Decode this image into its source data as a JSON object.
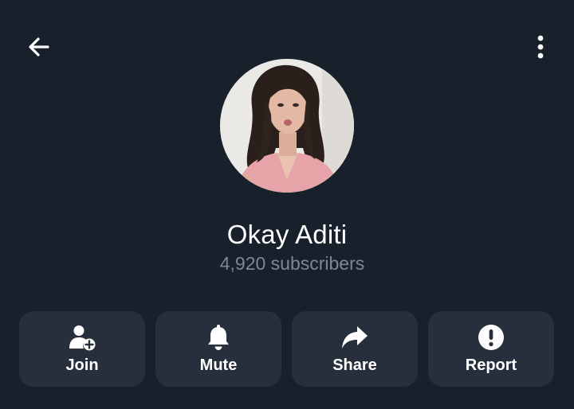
{
  "header": {
    "back_icon": "arrow-left-icon",
    "menu_icon": "more-vertical-icon"
  },
  "channel": {
    "name": "Okay Aditi",
    "subscribers": "4,920 subscribers",
    "avatar_icon": "channel-avatar-photo"
  },
  "actions": [
    {
      "label": "Join",
      "icon": "add-user-icon"
    },
    {
      "label": "Mute",
      "icon": "bell-icon"
    },
    {
      "label": "Share",
      "icon": "share-arrow-icon"
    },
    {
      "label": "Report",
      "icon": "alert-circle-icon"
    }
  ],
  "colors": {
    "background": "#18202b",
    "button_background": "#262f3b",
    "subtitle": "#7d8894",
    "text": "#ffffff"
  }
}
